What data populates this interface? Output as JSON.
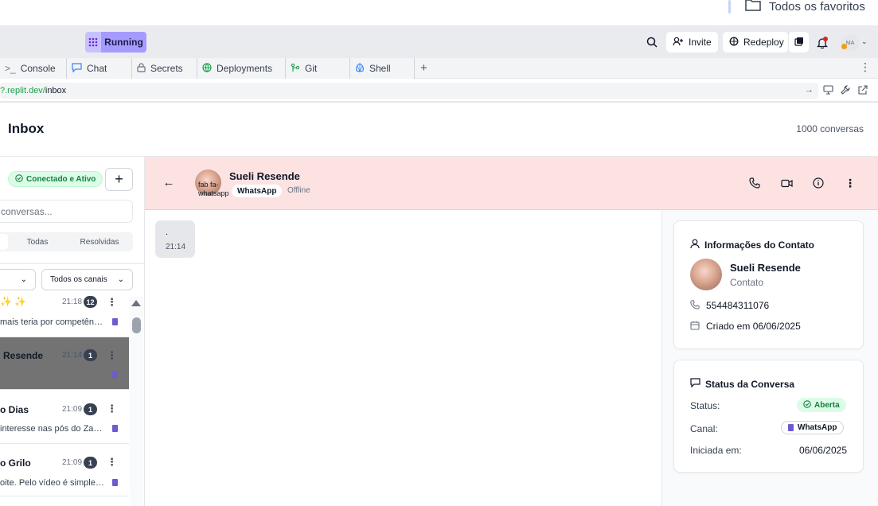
{
  "browser": {
    "favorites_label": "Todos os favoritos"
  },
  "replit": {
    "status_label": "Running",
    "invite_label": "Invite",
    "redeploy_label": "Redeploy",
    "avatar_initials": "MA"
  },
  "tabs": [
    {
      "label": "Console",
      "icon": ">_"
    },
    {
      "label": "Chat",
      "icon": "chat"
    },
    {
      "label": "Secrets",
      "icon": "lock"
    },
    {
      "label": "Deployments",
      "icon": "globe"
    },
    {
      "label": "Git",
      "icon": "git"
    },
    {
      "label": "Shell",
      "icon": "shell"
    }
  ],
  "url": {
    "domain_part": "?.replit.dev/",
    "path_part": "inbox"
  },
  "app": {
    "title": "Inbox",
    "conversation_count": "1000 conversas"
  },
  "sidebar": {
    "status_label": "Conectado e Ativo",
    "add_label": "+",
    "search_placeholder": "conversas...",
    "filter_tabs": [
      "Todas",
      "Resolvidas"
    ],
    "channel_filter": "Todos os canais",
    "conversations": [
      {
        "name": "✨ ✨",
        "time": "21:18",
        "unread": "12",
        "preview": "mais teria por competência"
      },
      {
        "name": "Resende",
        "time": "21:14",
        "unread": "1",
        "preview": ""
      },
      {
        "name": "o Dias",
        "time": "21:09",
        "unread": "1",
        "preview": "interesse nas pós do Zanone"
      },
      {
        "name": "o Grilo",
        "time": "21:09",
        "unread": "1",
        "preview": "oite. Pelo vídeo é simples demais"
      }
    ]
  },
  "chat": {
    "contact_name": "Sueli Resende",
    "avatar_alt": "fab fa-whatsapp",
    "channel_tag": "WhatsApp",
    "presence": "Offline",
    "messages": [
      {
        "text": ".",
        "time": "21:14"
      }
    ]
  },
  "contact_info": {
    "title": "Informações do Contato",
    "name": "Sueli Resende",
    "role": "Contato",
    "phone": "554484311076",
    "created": "Criado em 06/06/2025"
  },
  "conversation_status": {
    "title": "Status da Conversa",
    "status_label": "Status:",
    "status_value": "Aberta",
    "channel_label": "Canal:",
    "channel_value": "WhatsApp",
    "started_label": "Iniciada em:",
    "started_value": "06/06/2025"
  },
  "colors": {
    "chat_header_bg": "#fde2e2",
    "running_accent": "#a59bff",
    "success_green": "#15803d",
    "whatsapp_badge": "#6d5bd0"
  }
}
